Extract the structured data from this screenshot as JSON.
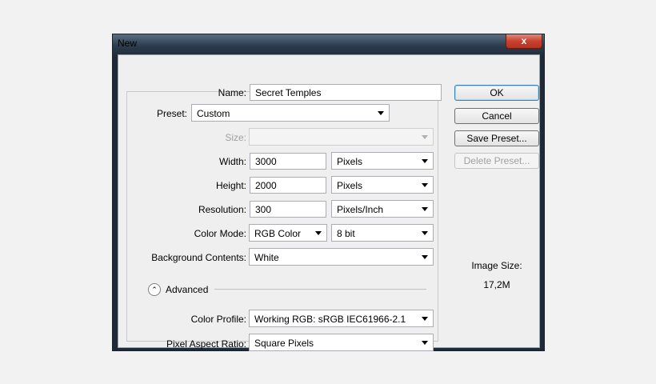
{
  "window": {
    "title": "New",
    "close_label": "x"
  },
  "form": {
    "name_label": "Name:",
    "name_value": "Secret Temples",
    "preset_label": "Preset:",
    "preset_value": "Custom",
    "size_label": "Size:",
    "size_value": "",
    "width_label": "Width:",
    "width_value": "3000",
    "width_unit": "Pixels",
    "height_label": "Height:",
    "height_value": "2000",
    "height_unit": "Pixels",
    "resolution_label": "Resolution:",
    "resolution_value": "300",
    "resolution_unit": "Pixels/Inch",
    "color_mode_label": "Color Mode:",
    "color_mode_value": "RGB Color",
    "bit_depth_value": "8 bit",
    "bg_label": "Background Contents:",
    "bg_value": "White",
    "advanced_label": "Advanced",
    "color_profile_label": "Color Profile:",
    "color_profile_value": "Working RGB:  sRGB IEC61966-2.1",
    "pixel_aspect_label": "Pixel Aspect Ratio:",
    "pixel_aspect_value": "Square Pixels"
  },
  "buttons": {
    "ok": "OK",
    "cancel": "Cancel",
    "save_preset": "Save Preset...",
    "delete_preset": "Delete Preset..."
  },
  "image_size": {
    "label": "Image Size:",
    "value": "17,2M"
  }
}
